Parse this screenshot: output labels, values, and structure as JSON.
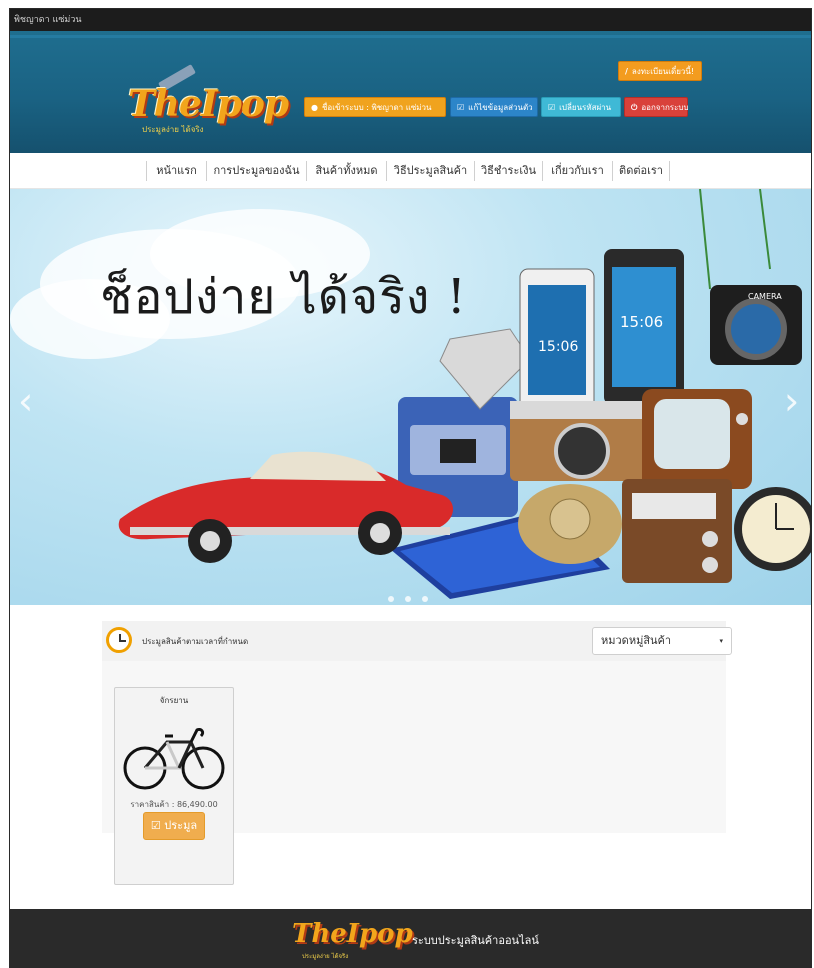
{
  "topbar": {
    "user_text": "พิชญาดา แซ่ม่วน"
  },
  "logo": {
    "brand": "TheIpop",
    "tagline": "ประมูลง่าย ได้จริง"
  },
  "header_buttons": {
    "register": "ลงทะเบียนเดี๋ยวนี้!",
    "user": "ชื่อเข้าระบบ : พิชญาดา แซ่ม่วน",
    "edit_profile": "แก้ไขข้อมูลส่วนตัว",
    "change_password": "เปลี่ยนรหัสผ่าน",
    "logout": "ออกจากระบบ"
  },
  "nav": [
    {
      "label": "หน้าแรก"
    },
    {
      "label": "การประมูลของฉัน"
    },
    {
      "label": "สินค้าทั้งหมด"
    },
    {
      "label": "วิธีประมูลสินค้า"
    },
    {
      "label": "วิธีชำระเงิน"
    },
    {
      "label": "เกี่ยวกับเรา"
    },
    {
      "label": "ติดต่อเรา"
    }
  ],
  "hero": {
    "headline": "ช็อปง่าย ได้จริง !",
    "arrow_left": "‹",
    "arrow_right": "›",
    "phone_time": "15:06",
    "camera_label": "CAMERA"
  },
  "auction": {
    "title": "ประมูลสินค้าตามเวลาที่กำหนด",
    "category_select": "หมวดหมู่สินค้า",
    "items": [
      {
        "name": "จักรยาน",
        "price": "ราคาสินค้า : 86,490.00",
        "bid_label": "ประมูล"
      }
    ]
  },
  "footer": {
    "brand": "TheIpop",
    "tagline": "ประมูลง่าย ได้จริง",
    "text": "ระบบประมูลสินค้าออนไลน์"
  },
  "colors": {
    "header_blue": "#1a6283",
    "brand_orange": "#f2a51c",
    "btn_orange": "#f0a31e",
    "btn_blue": "#2c85c9",
    "btn_cyan": "#3fb9d6",
    "btn_red": "#d9413a",
    "footer_dark": "#2a2a2a"
  }
}
